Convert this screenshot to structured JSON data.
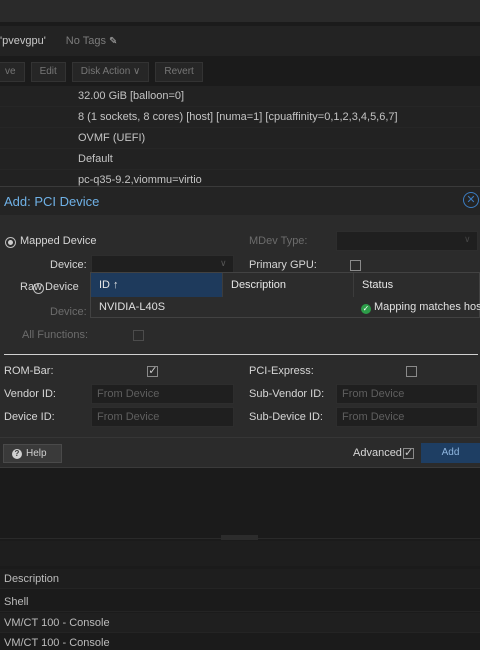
{
  "vm": {
    "name": "'pvevgpu'",
    "tags": "No Tags"
  },
  "toolbar": {
    "buttons": [
      "ve",
      "Edit",
      "Disk Action ∨",
      "Revert"
    ]
  },
  "hardware": [
    "32.00 GiB [balloon=0]",
    "8 (1 sockets, 8 cores) [host] [numa=1] [cpuaffinity=0,1,2,3,4,5,6,7]",
    "OVMF (UEFI)",
    "Default",
    "pc-q35-9.2,viommu=virtio"
  ],
  "dialog": {
    "title": "Add: PCI Device",
    "mapped_device": "Mapped Device",
    "raw_device": "Raw Device",
    "device": "Device:",
    "device_raw": "Device:",
    "all_functions": "All Functions:",
    "mdev_type": "MDev Type:",
    "primary_gpu": "Primary GPU:",
    "rom_bar": "ROM-Bar:",
    "pci_express": "PCI-Express:",
    "vendor_id": "Vendor ID:",
    "device_id": "Device ID:",
    "sub_vendor_id": "Sub-Vendor ID:",
    "sub_device_id": "Sub-Device ID:",
    "placeholder": "From Device",
    "help": "Help",
    "advanced": "Advanced",
    "add": "Add"
  },
  "grid": {
    "col_id": "ID ↑",
    "col_description": "Description",
    "col_status": "Status",
    "row_id": "NVIDIA-L40S",
    "row_status": "Mapping matches host"
  },
  "tasks": {
    "header": "Description",
    "rows": [
      "Shell",
      "VM/CT 100 - Console",
      "VM/CT 100 - Console"
    ]
  }
}
